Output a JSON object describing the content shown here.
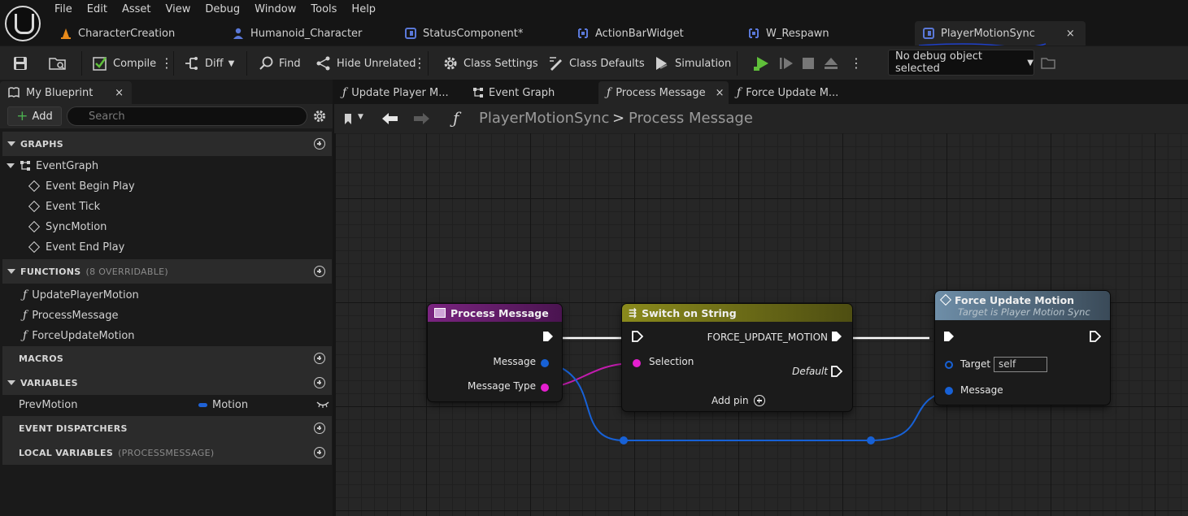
{
  "menu": [
    "File",
    "Edit",
    "Asset",
    "View",
    "Debug",
    "Window",
    "Tools",
    "Help"
  ],
  "doc_tabs": [
    {
      "label": "CharacterCreation",
      "icon": "traffic-cone-icon"
    },
    {
      "label": "Humanoid_Character",
      "icon": "person-icon"
    },
    {
      "label": "StatusComponent*",
      "icon": "component-icon"
    },
    {
      "label": "ActionBarWidget",
      "icon": "widget-icon"
    },
    {
      "label": "W_Respawn",
      "icon": "widget-icon"
    },
    {
      "label": "PlayerMotionSync",
      "icon": "component-icon",
      "active": true,
      "close": "×"
    }
  ],
  "toolbar": {
    "compile": "Compile",
    "diff": "Diff",
    "find": "Find",
    "hide_unrelated": "Hide Unrelated",
    "class_settings": "Class Settings",
    "class_defaults": "Class Defaults",
    "simulation": "Simulation",
    "debug_object": "No debug object selected"
  },
  "my_blueprint": {
    "tab_label": "My Blueprint",
    "close": "×",
    "add_label": "Add",
    "search_placeholder": "Search",
    "sections": {
      "graphs": "GRAPHS",
      "functions": "FUNCTIONS",
      "functions_sub": "(8 OVERRIDABLE)",
      "macros": "MACROS",
      "variables": "VARIABLES",
      "event_dispatchers": "EVENT DISPATCHERS",
      "local_variables": "LOCAL VARIABLES",
      "local_variables_sub": "(PROCESSMESSAGE)"
    },
    "event_graph": "EventGraph",
    "events": [
      "Event Begin Play",
      "Event Tick",
      "SyncMotion",
      "Event End Play"
    ],
    "functions": [
      "UpdatePlayerMotion",
      "ProcessMessage",
      "ForceUpdateMotion"
    ],
    "variables": [
      {
        "name": "PrevMotion",
        "type": "Motion",
        "type_color": "#1f62d6"
      }
    ]
  },
  "graph_tabs": [
    {
      "label": "Update Player M...",
      "icon": "function-icon"
    },
    {
      "label": "Event Graph",
      "icon": "event-graph-icon"
    },
    {
      "label": "Process Message",
      "icon": "function-icon",
      "active": true,
      "close": "×"
    },
    {
      "label": "Force Update M...",
      "icon": "function-icon"
    }
  ],
  "breadcrumb": {
    "root": "PlayerMotionSync",
    "separator": ">",
    "current": "Process Message"
  },
  "nodes": {
    "entry": {
      "title": "Process Message",
      "header_color": "#6c1f6e",
      "pins": [
        "Message",
        "Message Type"
      ]
    },
    "switch": {
      "title": "Switch on String",
      "header_color": "#7d7d1c",
      "selection": "Selection",
      "case": "FORCE_UPDATE_MOTION",
      "default": "Default",
      "add_pin": "Add pin"
    },
    "call": {
      "title": "Force Update Motion",
      "subtitle": "Target is Player Motion Sync",
      "header_color": "#5b7b92",
      "target": "Target",
      "target_value": "self",
      "message": "Message"
    }
  },
  "colors": {
    "string_pin": "#e51fcf",
    "struct_pin": "#1761d6",
    "exec_pin": "#ffffff",
    "accent_underline": "#1e3fc8"
  }
}
